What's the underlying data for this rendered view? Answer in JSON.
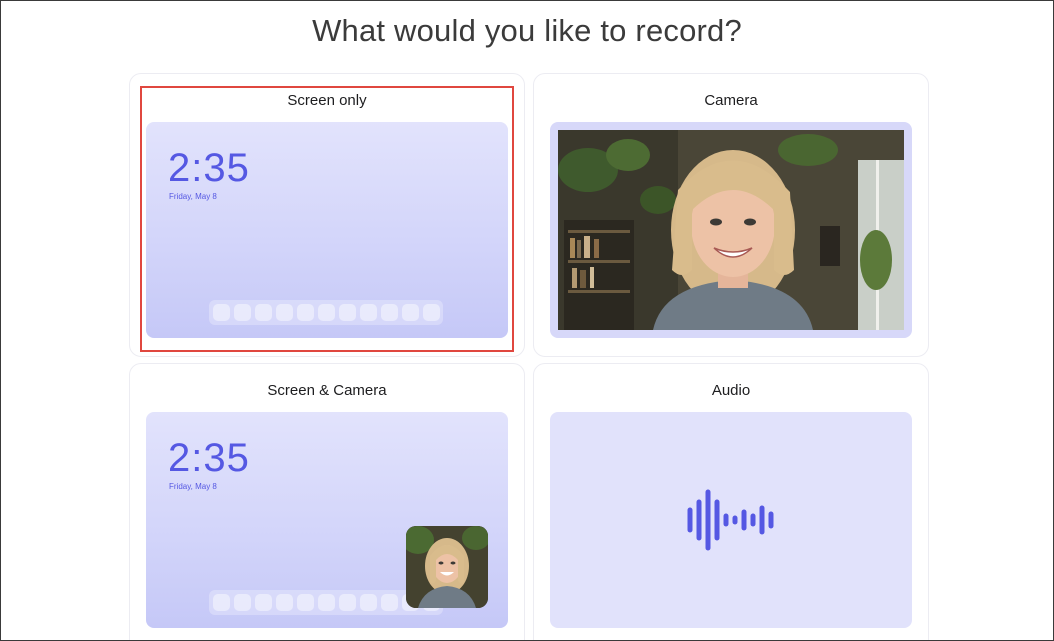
{
  "title": "What would you like to record?",
  "options": [
    {
      "label": "Screen only",
      "selected": true
    },
    {
      "label": "Camera",
      "selected": false
    },
    {
      "label": "Screen & Camera",
      "selected": false
    },
    {
      "label": "Audio",
      "selected": false
    }
  ],
  "screen_preview": {
    "time": "2:35",
    "date": "Friday, May 8",
    "dock_icon_count": 11
  },
  "icons": {
    "audio": "audio-waveform-icon",
    "camera": "person-photo",
    "pip": "camera-pip-photo"
  },
  "colors": {
    "accent": "#5558e3",
    "preview_bg": "#d8d9fb",
    "selection_border": "#e0473f",
    "title_text": "#3b3b3b"
  }
}
